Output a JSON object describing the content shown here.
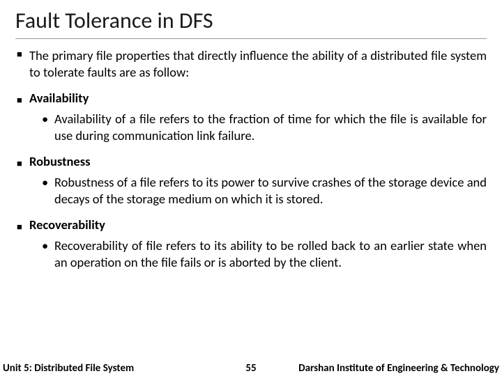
{
  "title": "Fault Tolerance in DFS",
  "intro": "The primary file properties that directly influence the ability of a distributed file system to tolerate faults are as follow:",
  "sections": [
    {
      "heading": "Availability",
      "body": "Availability of a file refers to the fraction of time for which the file is available for use during communication link failure."
    },
    {
      "heading": "Robustness",
      "body": "Robustness of a file refers to its power to survive crashes of the storage device and decays of the storage medium on which it is stored."
    },
    {
      "heading": "Recoverability",
      "body": "Recoverability of file refers to its ability to be rolled back to an earlier state when an operation on the file fails or is aborted by the client."
    }
  ],
  "footer": {
    "left": "Unit 5: Distributed File System",
    "page": "55",
    "right": "Darshan Institute of Engineering & Technology"
  }
}
